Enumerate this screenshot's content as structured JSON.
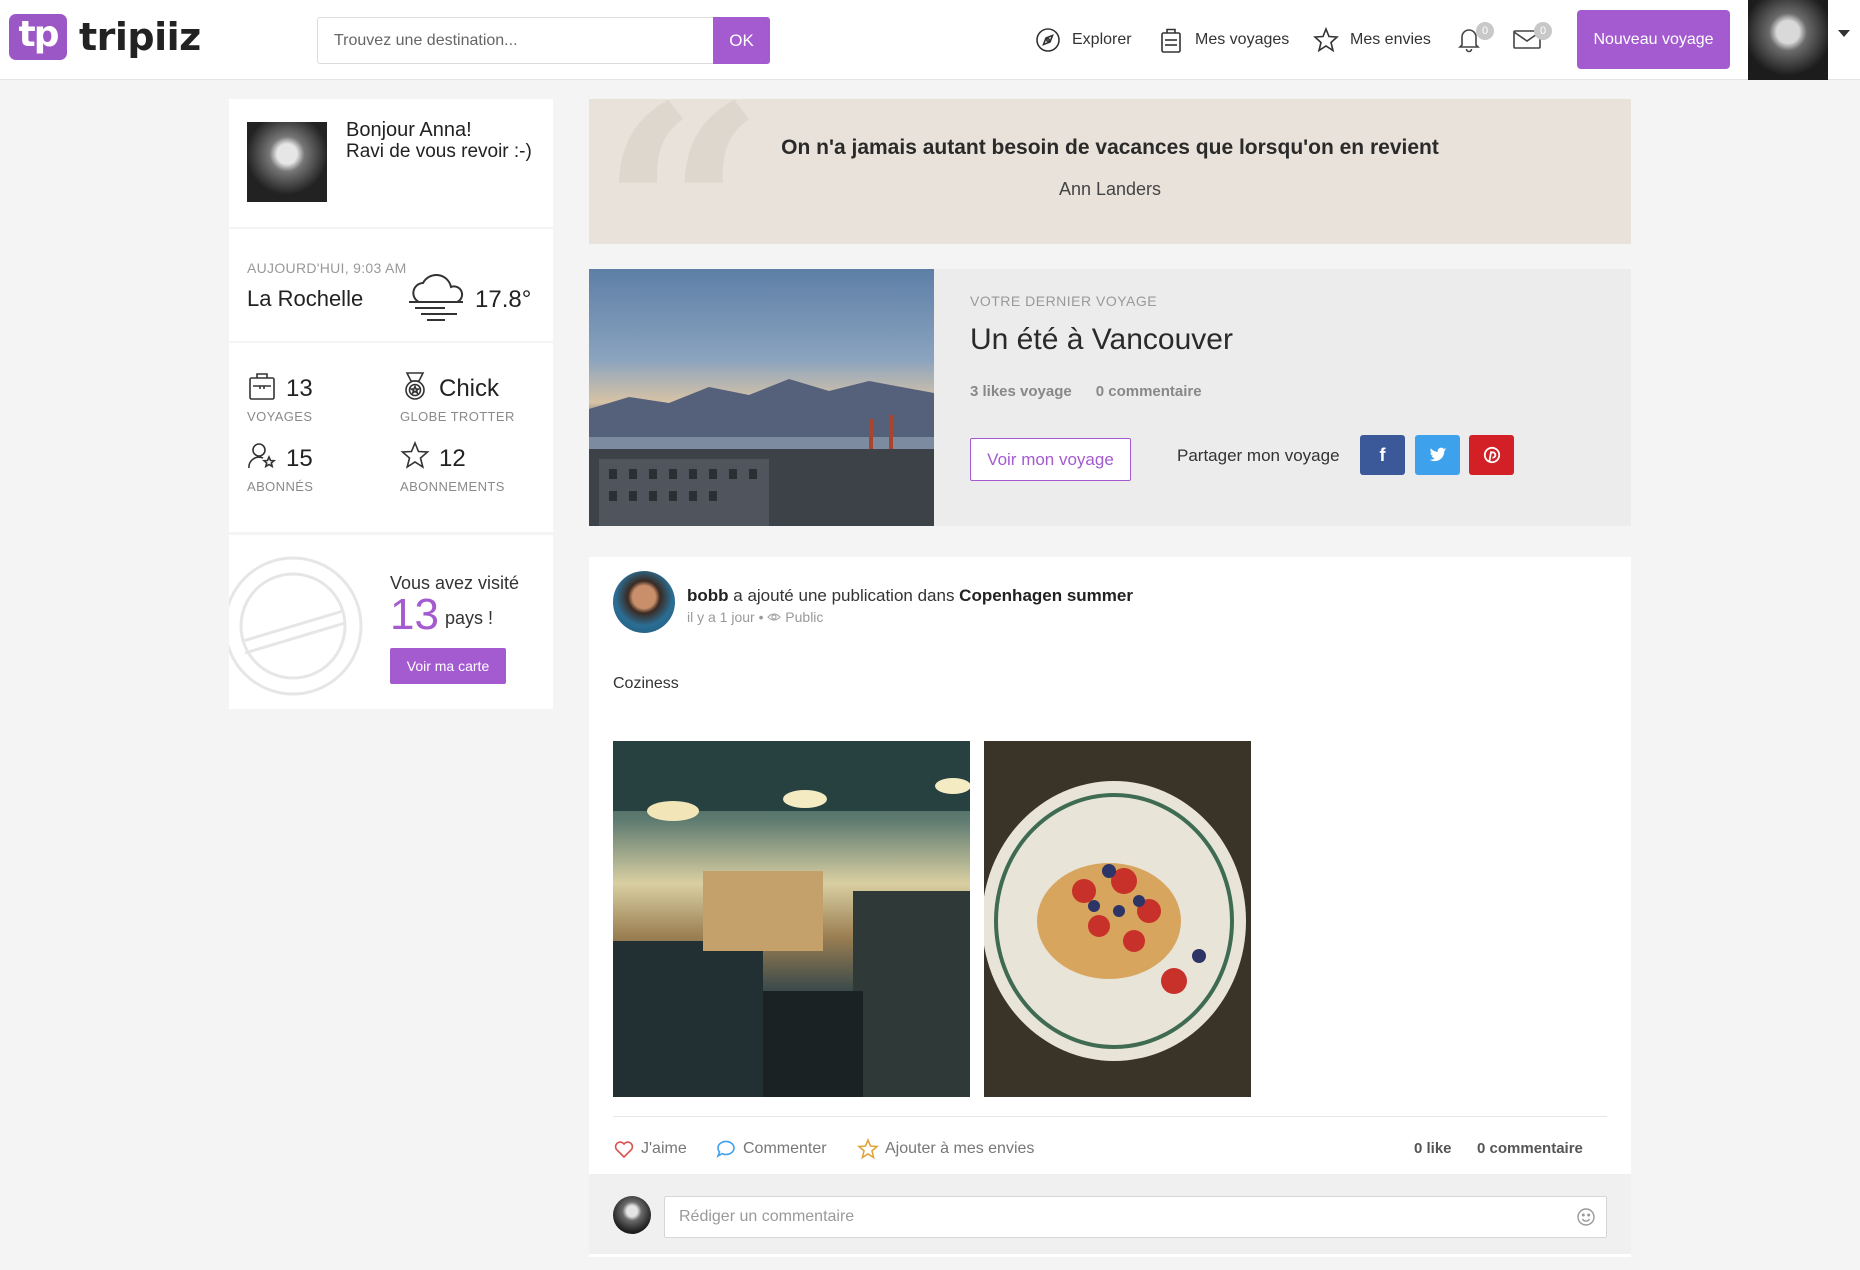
{
  "header": {
    "logo_mark": "tp",
    "logo_word": "tripiiz",
    "search_placeholder": "Trouvez une destination...",
    "search_button": "OK",
    "nav": {
      "explorer": "Explorer",
      "voyages": "Mes voyages",
      "envies": "Mes envies"
    },
    "notifications_count": "0",
    "messages_count": "0",
    "new_trip_button": "Nouveau voyage"
  },
  "profile": {
    "greeting": "Bonjour Anna!",
    "greeting_sub": "Ravi de vous revoir :-)"
  },
  "weather": {
    "time": "AUJOURD'HUI, 9:03 AM",
    "city": "La Rochelle",
    "temperature": "17.8°"
  },
  "stats": {
    "voyages_num": "13",
    "voyages_label": "VOYAGES",
    "rank_num": "Chick",
    "rank_label": "GLOBE TROTTER",
    "abonnes_num": "15",
    "abonnes_label": "ABONNÉS",
    "abonnements_num": "12",
    "abonnements_label": "ABONNEMENTS"
  },
  "visits": {
    "line1": "Vous avez visité",
    "count": "13",
    "unit": "pays !",
    "button": "Voir ma carte"
  },
  "quote": {
    "text": "On n'a jamais autant besoin de vacances que lorsqu'on en revient",
    "author": "Ann Landers"
  },
  "last_trip": {
    "kicker": "VOTRE DERNIER VOYAGE",
    "title": "Un été à Vancouver",
    "likes": "3 likes voyage",
    "comments": "0 commentaire",
    "button": "Voir mon voyage",
    "share_label": "Partager mon voyage",
    "share_fb": "f",
    "share_tw": "t",
    "share_pi": "p"
  },
  "post": {
    "author": "bobb",
    "action_text": " a ajouté une publication dans ",
    "album": "Copenhagen summer",
    "time": "il y a 1 jour",
    "visibility": "Public",
    "body": "Coziness",
    "like_action": "J'aime",
    "comment_action": "Commenter",
    "wish_action": "Ajouter à mes envies",
    "like_count": "0 like",
    "comment_count": "0 commentaire",
    "comment_placeholder": "Rédiger un commentaire"
  },
  "colors": {
    "accent": "#a45bd0",
    "facebook": "#3b5998",
    "twitter": "#3ea1ec",
    "pinterest": "#d31f26",
    "quote_bg": "#e8e2da"
  }
}
